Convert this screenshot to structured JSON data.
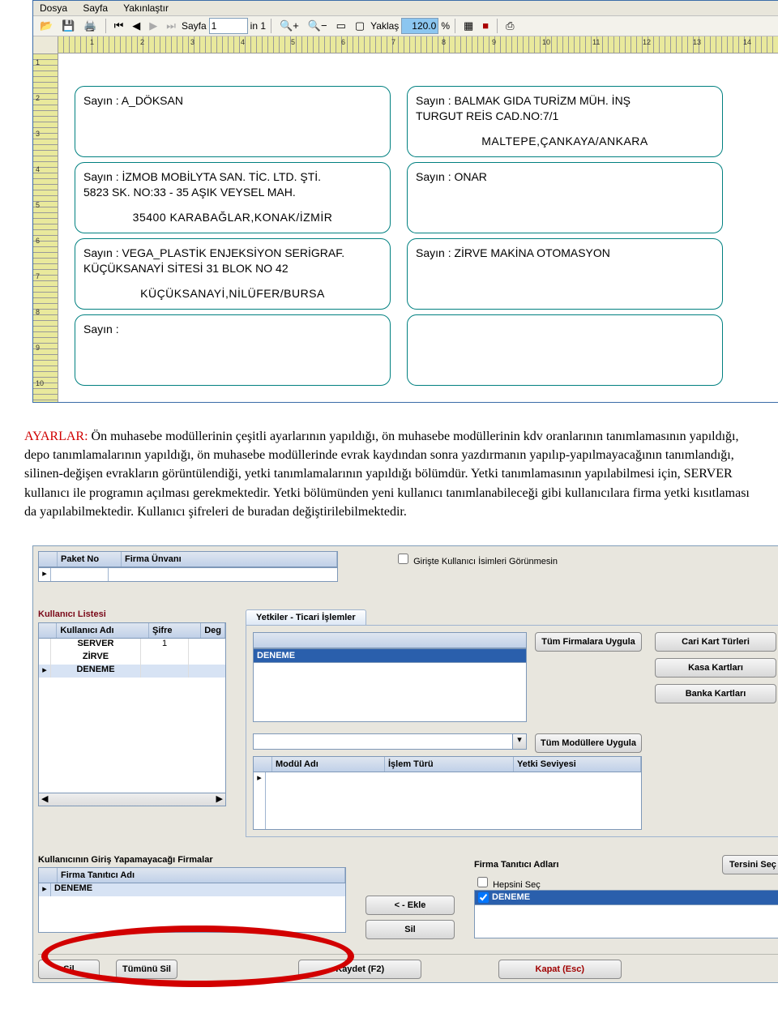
{
  "preview": {
    "menu": {
      "dosya": "Dosya",
      "sayfa": "Sayfa",
      "yakinlastir": "Yakınlaştır"
    },
    "toolbar": {
      "page_label": "Sayfa",
      "page_value": "1",
      "in_label": "in 1",
      "zoom_label": "Yaklaş",
      "zoom_value": "120.0",
      "percent": "%"
    },
    "ruler_h": [
      "1",
      "2",
      "3",
      "4",
      "5",
      "6",
      "7",
      "8",
      "9",
      "10",
      "11",
      "12",
      "13",
      "14"
    ],
    "ruler_v": [
      "1",
      "2",
      "3",
      "4",
      "5",
      "6",
      "7",
      "8",
      "9",
      "10"
    ],
    "labels": [
      {
        "line1": "Sayın : A_DÖKSAN",
        "line2": "",
        "addr": ""
      },
      {
        "line1": "Sayın : BALMAK GIDA TURİZM MÜH. İNŞ",
        "line2": "TURGUT REİS CAD.NO:7/1",
        "addr": "MALTEPE,ÇANKAYA/ANKARA"
      },
      {
        "line1": "Sayın : İZMOB MOBİLYTA SAN. TİC. LTD. ŞTİ.",
        "line2": "5823 SK. NO:33 - 35 AŞIK VEYSEL MAH.",
        "addr": "35400 KARABAĞLAR,KONAK/İZMİR"
      },
      {
        "line1": "Sayın : ONAR",
        "line2": "",
        "addr": ""
      },
      {
        "line1": "Sayın : VEGA_PLASTİK ENJEKSİYON SERİGRAF.",
        "line2": "KÜÇÜKSANAYİ SİTESİ 31 BLOK NO 42",
        "addr": "KÜÇÜKSANAYİ,NİLÜFER/BURSA"
      },
      {
        "line1": "Sayın : ZİRVE MAKİNA OTOMASYON",
        "line2": "",
        "addr": ""
      },
      {
        "line1": "Sayın :",
        "line2": "",
        "addr": ""
      },
      {
        "line1": "",
        "line2": "",
        "addr": ""
      }
    ]
  },
  "narrative": {
    "title": "AYARLAR:",
    "body": "Ön muhasebe modüllerinin çeşitli ayarlarının yapıldığı, ön muhasebe modüllerinin kdv oranlarının tanımlamasının yapıldığı, depo tanımlamalarının yapıldığı, ön muhasebe modüllerinde evrak kaydından sonra yazdırmanın yapılıp-yapılmayacağının tanımlandığı, silinen-değişen evrakların görüntülendiği, yetki tanımlamalarının yapıldığı bölümdür. Yetki tanımlamasının yapılabilmesi için, SERVER kullanıcı ile programın açılması gerekmektedir. Yetki bölümünden yeni kullanıcı tanımlanabileceği gibi kullanıcılara firma yetki kısıtlaması da yapılabilmektedir. Kullanıcı şifreleri de buradan değiştirilebilmektedir."
  },
  "yetki": {
    "top_grid": {
      "col1": "Paket No",
      "col2": "Firma Ünvanı"
    },
    "checkbox_label": "Girişte Kullanıcı İsimleri Görünmesin",
    "kullanici_listesi": {
      "title": "Kullanıcı Listesi",
      "cols": [
        "Kullanıcı Adı",
        "Şifre",
        "Deg"
      ],
      "rows": [
        {
          "ad": "SERVER",
          "sifre": "1"
        },
        {
          "ad": "ZİRVE",
          "sifre": ""
        },
        {
          "ad": "DENEME",
          "sifre": ""
        }
      ]
    },
    "tab_label": "Yetkiler - Ticari İşlemler",
    "firma_listesi_selected": "DENEME",
    "btn_tum_firmalara": "Tüm Firmalara Uygula",
    "btn_cari": "Cari Kart Türleri",
    "btn_kasa": "Kasa Kartları",
    "btn_banka": "Banka Kartları",
    "btn_tum_modul": "Tüm Modüllere Uygula",
    "mod_cols": [
      "Modül Adı",
      "İşlem Türü",
      "Yetki Seviyesi"
    ],
    "restrict_title": "Kullanıcının Giriş Yapamayacağı Firmalar",
    "restrict_col": "Firma Tanıtıcı Adı",
    "restrict_row": "DENEME",
    "firma_tanitici_title": "Firma Tanıtıcı Adları",
    "hepsini_sec": "Hepsini Seç",
    "tersini_sec": "Tersini Seç",
    "firma_tanitici_row": "DENEME",
    "btn_ekle": "< - Ekle",
    "btn_sil_small": "Sil",
    "btn_sil": "Sil",
    "btn_tumunu_sil": "Tümünü Sil",
    "btn_kaydet": "Kaydet (F2)",
    "btn_kapat": "Kapat (Esc)"
  }
}
